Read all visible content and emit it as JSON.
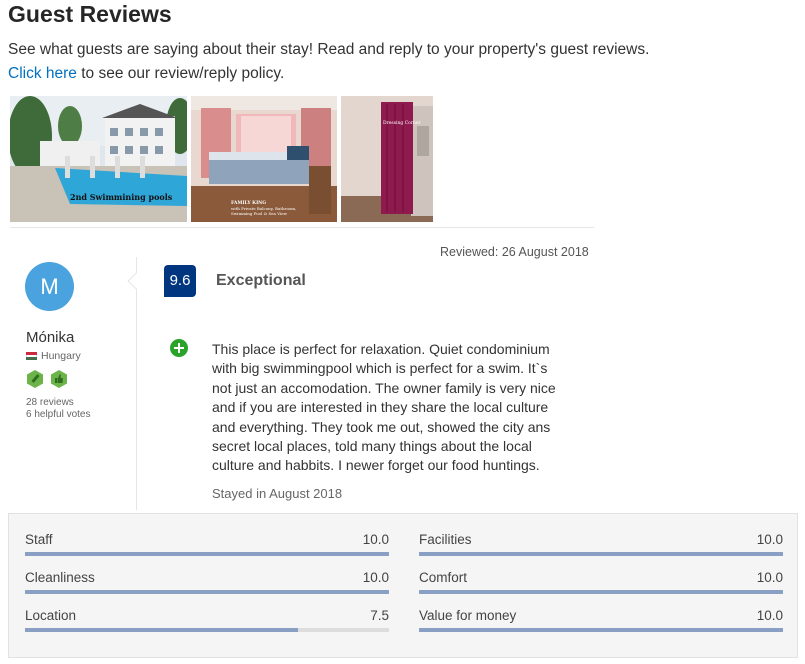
{
  "page": {
    "title": "Guest Reviews",
    "intro_text": "See what guests are saying about their stay! Read and reply to your property's guest reviews.",
    "policy_link": "Click here",
    "policy_suffix": " to see our review/reply policy."
  },
  "photos": [
    {
      "caption": "2nd Swimmining pools"
    },
    {
      "caption_line1": "FAMILY KING",
      "caption_line2": "with Private Balcony, Bathroom,",
      "caption_line3": "Swimming Pool & Sea View"
    },
    {
      "caption": "Dressing Corner"
    }
  ],
  "review": {
    "reviewed_date": "Reviewed: 26 August 2018",
    "reviewer": {
      "initial": "M",
      "name": "Mónika",
      "country": "Hungary",
      "reviews_count": "28 reviews",
      "helpful_votes": "6 helpful votes"
    },
    "score": "9.6",
    "score_word": "Exceptional",
    "text": "This place is perfect for relaxation. Quiet condominium with big swimmingpool which is perfect for a swim. It`s not just an accomodation. The owner family is very nice and if you are interested in they share the local culture and everything. They took me out, showed the city ans secret local places, told many things about the local culture and habbits. I newer forget our food huntings.",
    "stayed": "Stayed in August 2018"
  },
  "colors": {
    "accent_blue": "#003580",
    "link_blue": "#0071c2",
    "avatar_blue": "#4aa3df",
    "positive_green": "#2aa32a",
    "bar_fill": "#8a9fc4"
  },
  "category_scores": [
    {
      "label": "Staff",
      "value": "10.0",
      "fraction": 1.0
    },
    {
      "label": "Facilities",
      "value": "10.0",
      "fraction": 1.0
    },
    {
      "label": "Cleanliness",
      "value": "10.0",
      "fraction": 1.0
    },
    {
      "label": "Comfort",
      "value": "10.0",
      "fraction": 1.0
    },
    {
      "label": "Location",
      "value": "7.5",
      "fraction": 0.75
    },
    {
      "label": "Value for money",
      "value": "10.0",
      "fraction": 1.0
    }
  ]
}
